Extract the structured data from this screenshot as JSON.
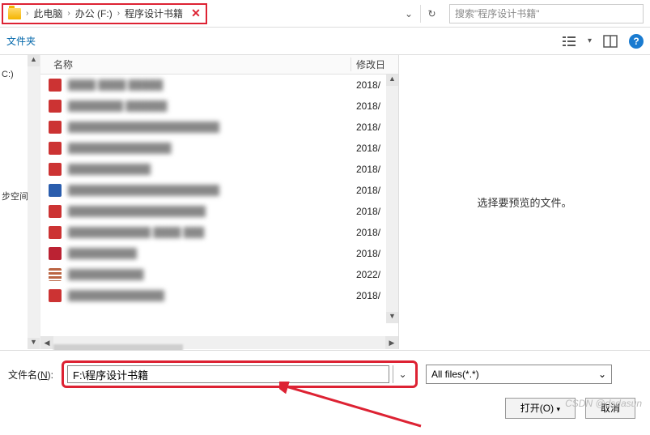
{
  "breadcrumb": {
    "items": [
      "此电脑",
      "办公 (F:)",
      "程序设计书籍"
    ]
  },
  "search": {
    "placeholder": "搜索\"程序设计书籍\""
  },
  "toolbar": {
    "left_label": "文件夹"
  },
  "sidebar": {
    "drive_c": "C:)",
    "sync": "步空间"
  },
  "columns": {
    "name": "名称",
    "date": "修改日"
  },
  "files": [
    {
      "date": "2018/"
    },
    {
      "date": "2018/"
    },
    {
      "date": "2018/"
    },
    {
      "date": "2018/"
    },
    {
      "date": "2018/"
    },
    {
      "date": "2018/"
    },
    {
      "date": "2018/"
    },
    {
      "date": "2018/"
    },
    {
      "date": "2018/"
    },
    {
      "date": "2022/"
    },
    {
      "date": "2018/"
    }
  ],
  "preview": {
    "empty_text": "选择要预览的文件。"
  },
  "filename": {
    "label_prefix": "文件名(",
    "label_hotkey": "N",
    "label_suffix": "):",
    "value": "F:\\程序设计书籍"
  },
  "filter": {
    "label": "All files(*.*)"
  },
  "buttons": {
    "open": "打开(O)",
    "cancel": "取消"
  },
  "watermark": "CSDN @dsdasun"
}
